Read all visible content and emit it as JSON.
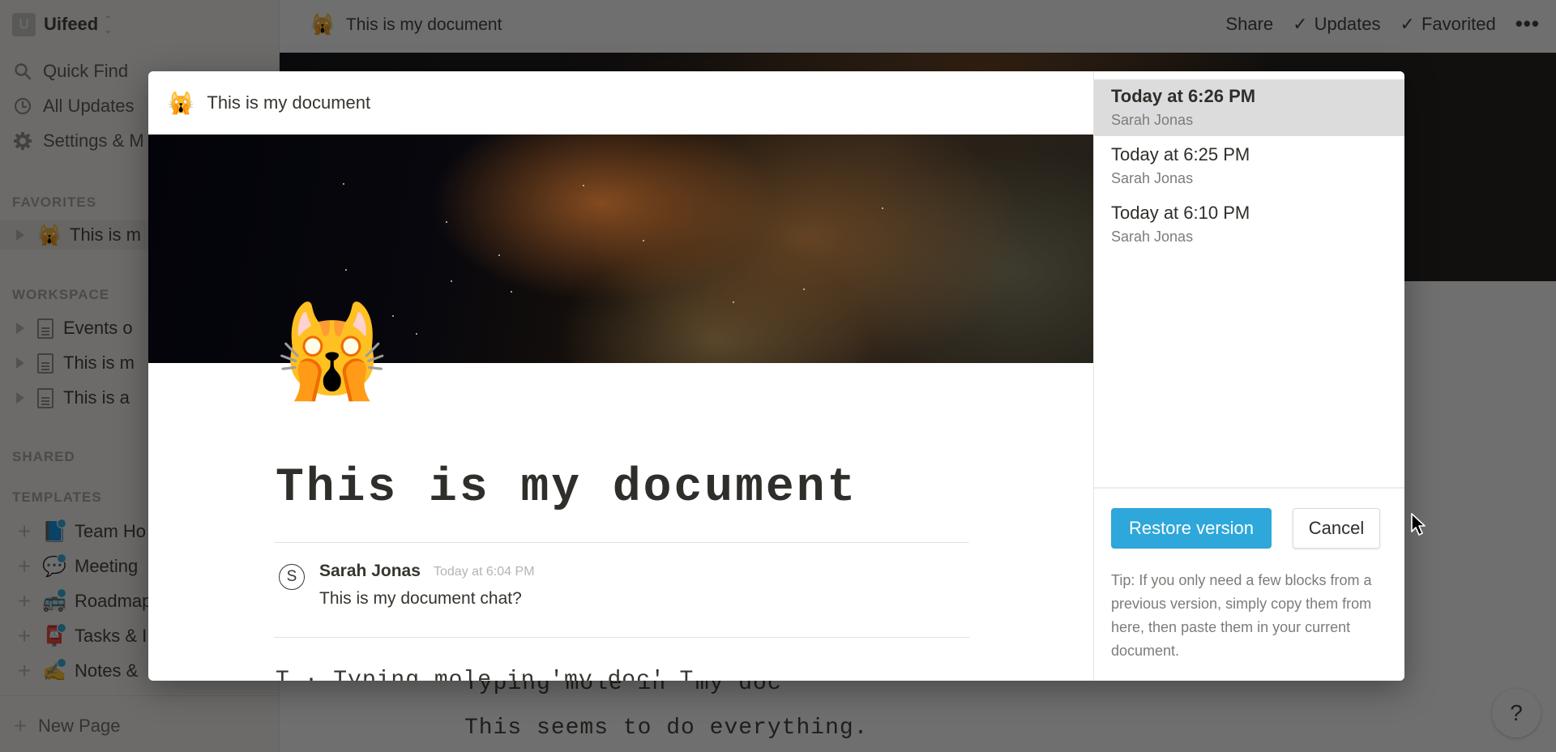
{
  "sidebar": {
    "workspace": {
      "initial": "U",
      "name": "Uifeed"
    },
    "nav": [
      {
        "icon": "search-icon",
        "label": "Quick Find"
      },
      {
        "icon": "clock-icon",
        "label": "All Updates"
      },
      {
        "icon": "gear-icon",
        "label": "Settings & M"
      }
    ],
    "sections": {
      "favorites": "FAVORITES",
      "workspace": "WORKSPACE",
      "shared": "SHARED",
      "templates": "TEMPLATES"
    },
    "favorites": [
      {
        "emoji": "🙀",
        "label": "This is m"
      }
    ],
    "workspace_pages": [
      {
        "label": "Events o"
      },
      {
        "label": "This is m"
      },
      {
        "label": "This is a"
      }
    ],
    "templates": [
      {
        "emoji": "📘",
        "label": "Team Ho"
      },
      {
        "emoji": "💬",
        "label": "Meeting"
      },
      {
        "emoji": "🚌",
        "label": "Roadmap"
      },
      {
        "emoji": "📮",
        "label": "Tasks & I"
      },
      {
        "emoji": "✍",
        "label": "Notes &"
      }
    ],
    "new_page": "New Page"
  },
  "topbar": {
    "page_emoji": "🙀",
    "page_title": "This is my document",
    "share": "Share",
    "updates": "Updates",
    "favorited": "Favorited",
    "more": "•••"
  },
  "background_doc": {
    "line1": "Typing mole in 'my doc' ",
    "line2": "This seems to do everything."
  },
  "help": "?",
  "modal": {
    "header": {
      "emoji": "🙀",
      "title": "This is my document"
    },
    "page_icon": "🙀",
    "doc_title": "This is my document",
    "comment": {
      "avatar_initial": "S",
      "author": "Sarah Jonas",
      "time": "Today at 6:04 PM",
      "text": "This is my document chat?"
    },
    "cut_text": "T ·                Typing mole in 'my doc'  T",
    "versions": [
      {
        "time": "Today at 6:26 PM",
        "author": "Sarah Jonas",
        "selected": true
      },
      {
        "time": "Today at 6:25 PM",
        "author": "Sarah Jonas",
        "selected": false
      },
      {
        "time": "Today at 6:10 PM",
        "author": "Sarah Jonas",
        "selected": false
      }
    ],
    "restore_label": "Restore version",
    "cancel_label": "Cancel",
    "tip": "Tip: If you only need a few blocks from a previous version, simply copy them from here, then paste them in your current document."
  },
  "colors": {
    "accent": "#2ea7da",
    "selected_version_bg": "#dcdcdc",
    "overlay": "rgba(15,15,15,0.6)"
  }
}
